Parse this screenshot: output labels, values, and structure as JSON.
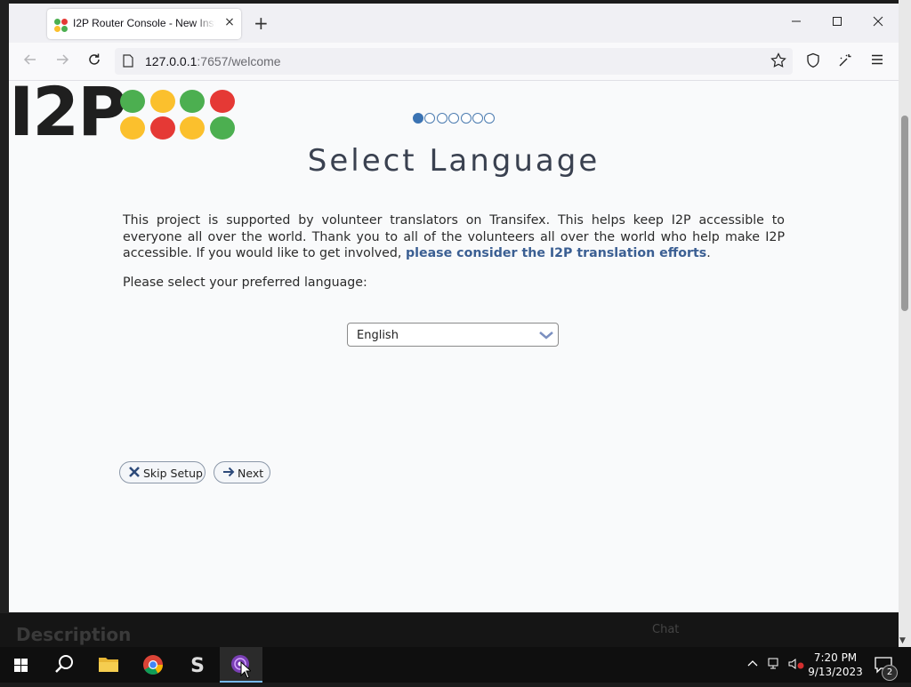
{
  "browser": {
    "tab_title": "I2P Router Console - New Install Wizard",
    "tab_close": "×",
    "new_tab": "+",
    "url_host": "127.0.0.1",
    "url_path": ":7657/welcome",
    "window_controls": {
      "minimize": "—",
      "maximize": "☐",
      "close": "✕"
    },
    "icons": [
      "back-icon",
      "forward-icon",
      "reload-icon",
      "page-icon",
      "bookmark-star-icon",
      "shield-icon",
      "extensions-icon",
      "menu-icon"
    ]
  },
  "page": {
    "logo_text": "I2P",
    "logo_dot_colors": [
      "#4caf50",
      "#fbc02d",
      "#4caf50",
      "#e53935",
      "#fbc02d",
      "#e53935",
      "#fbc02d",
      "#4caf50"
    ],
    "progress": {
      "steps": 7,
      "current": 1
    },
    "title": "Select Language",
    "intro_text": "This project is supported by volunteer translators on Transifex. This helps keep I2P accessible to everyone all over the world. Thank you to all of the volunteers all over the world who help make I2P accessible. If you would like to get involved, ",
    "intro_link": "please consider the I2P translation efforts",
    "intro_end": ".",
    "prompt": "Please select your preferred language:",
    "language_selected": "English",
    "skip_label": "Skip Setup",
    "next_label": "Next"
  },
  "background": {
    "description": "Description",
    "chat": "Chat"
  },
  "taskbar": {
    "time": "7:20 PM",
    "date": "9/13/2023",
    "notification_count": "2",
    "apps": [
      "windows-start-icon",
      "search-icon",
      "file-explorer-icon",
      "chrome-icon",
      "s-app-icon",
      "i2p-app-icon"
    ]
  }
}
